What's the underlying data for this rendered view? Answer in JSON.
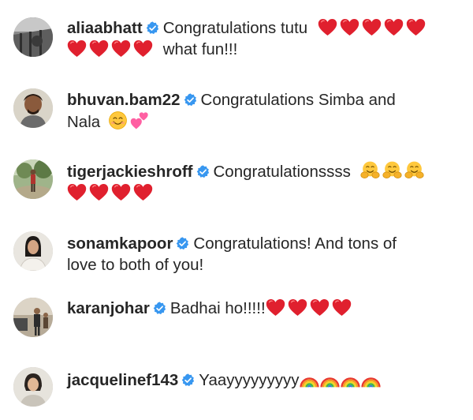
{
  "comments": [
    {
      "username": "aliaabhatt",
      "line1": "Congratulations tutu",
      "line1_emojis": [
        "heart",
        "heart",
        "heart",
        "heart",
        "heart"
      ],
      "line2_emojis": [
        "heart",
        "heart",
        "heart",
        "heart"
      ],
      "line2": "what fun!!!"
    },
    {
      "username": "bhuvan.bam22",
      "line1": "Congratulations Simba and",
      "line2": "Nala",
      "line2_emojis": [
        "smile-icon",
        "two-hearts-icon"
      ]
    },
    {
      "username": "tigerjackieshroff",
      "line1": "Congratulationssss",
      "line1_emojis": [
        "hug",
        "hug",
        "hug"
      ],
      "line2_emojis": [
        "heart",
        "heart",
        "heart",
        "heart"
      ]
    },
    {
      "username": "sonamkapoor",
      "line1": "Congratulations! And tons of",
      "line2": "love to both of you!"
    },
    {
      "username": "karanjohar",
      "line1": "Badhai ho!!!!!",
      "line1_emojis": [
        "heart",
        "heart",
        "heart",
        "heart"
      ]
    },
    {
      "username": "jacquelinef143",
      "line1": "Yaayyyyyyyyy",
      "line1_emojis": [
        "rainbow",
        "rainbow",
        "rainbow",
        "rainbow"
      ]
    }
  ],
  "colors": {
    "verified_badge": "#3897f0",
    "heart": "#e0202e",
    "text": "#262626"
  }
}
